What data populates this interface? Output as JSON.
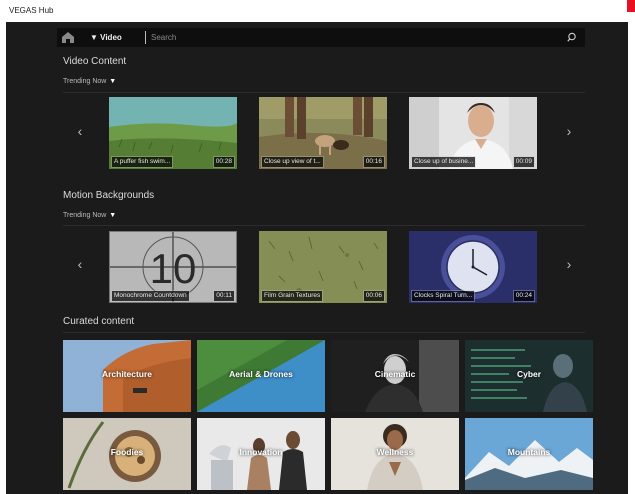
{
  "window": {
    "title": "VEGAS Hub"
  },
  "nav": {
    "video_label": "▼ Video",
    "search_placeholder": "Search"
  },
  "video_section": {
    "title": "Video Content",
    "filter": "Trending Now",
    "items": [
      {
        "caption": "A puffer fish swim...",
        "duration": "00:28"
      },
      {
        "caption": "Close up view of t...",
        "duration": "00:16"
      },
      {
        "caption": "Close up of busine...",
        "duration": "00:09"
      }
    ]
  },
  "motion_section": {
    "title": "Motion Backgrounds",
    "filter": "Trending Now",
    "items": [
      {
        "caption": "Monochrome Countdown",
        "duration": "00:11",
        "overlay_number": "10"
      },
      {
        "caption": "Film Grain Textures",
        "duration": "00:06"
      },
      {
        "caption": "Clocks Spiral Turn...",
        "duration": "00:24"
      }
    ]
  },
  "curated_section": {
    "title": "Curated content",
    "tiles": [
      {
        "label": "Architecture"
      },
      {
        "label": "Aerial & Drones"
      },
      {
        "label": "Cinematic"
      },
      {
        "label": "Cyber"
      },
      {
        "label": "Foodies"
      },
      {
        "label": "Innovation"
      },
      {
        "label": "Wellness"
      },
      {
        "label": "Mountains"
      }
    ]
  },
  "icons": {
    "home": "home-icon",
    "search": "search-icon",
    "prev": "chevron-left-icon",
    "next": "chevron-right-icon"
  },
  "colors": {
    "app_background": "#1b1b1b",
    "navbar_background": "#0e0e0e",
    "window_close": "#e81123"
  }
}
